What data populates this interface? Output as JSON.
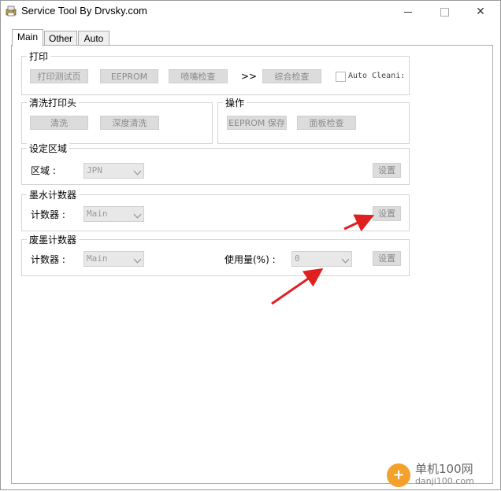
{
  "window": {
    "title": "Service Tool By Drvsky.com",
    "controls": {
      "minimize": "—",
      "maximize": "□",
      "close": "✕"
    }
  },
  "tabs": [
    {
      "label": "Main",
      "active": true
    },
    {
      "label": "Other",
      "active": false
    },
    {
      "label": "Auto",
      "active": false
    }
  ],
  "print_group": {
    "title": "打印",
    "buttons": {
      "test_page": "打印测试页",
      "eeprom": "EEPROM",
      "nozzle_check": "喷嘴检查",
      "combined_check": "综合检查"
    },
    "separator": ">>",
    "auto_clean_label": "Auto Cleani:"
  },
  "head_clean_group": {
    "title": "清洗打印头",
    "buttons": {
      "clean": "清洗",
      "deep_clean": "深度清洗"
    }
  },
  "operation_group": {
    "title": "操作",
    "buttons": {
      "eeprom_save": "EEPROM 保存",
      "panel_check": "面板检查"
    }
  },
  "region_group": {
    "title": "设定区域",
    "label": "区域 :",
    "combo_value": "JPN",
    "set_button": "设置"
  },
  "ink_counter_group": {
    "title": "墨水计数器",
    "label": "计数器 :",
    "combo_value": "Main",
    "set_button": "设置"
  },
  "waste_ink_group": {
    "title": "废墨计数器",
    "label": "计数器 :",
    "combo_value": "Main",
    "usage_label": "使用量(%) :",
    "usage_value": "0",
    "set_button": "设置"
  },
  "watermark": {
    "line1": "单机100网",
    "line2": "danji100.com",
    "icon": "plus-circle-icon"
  },
  "colors": {
    "arrow": "#e02020",
    "watermark": "#f3a12b"
  }
}
